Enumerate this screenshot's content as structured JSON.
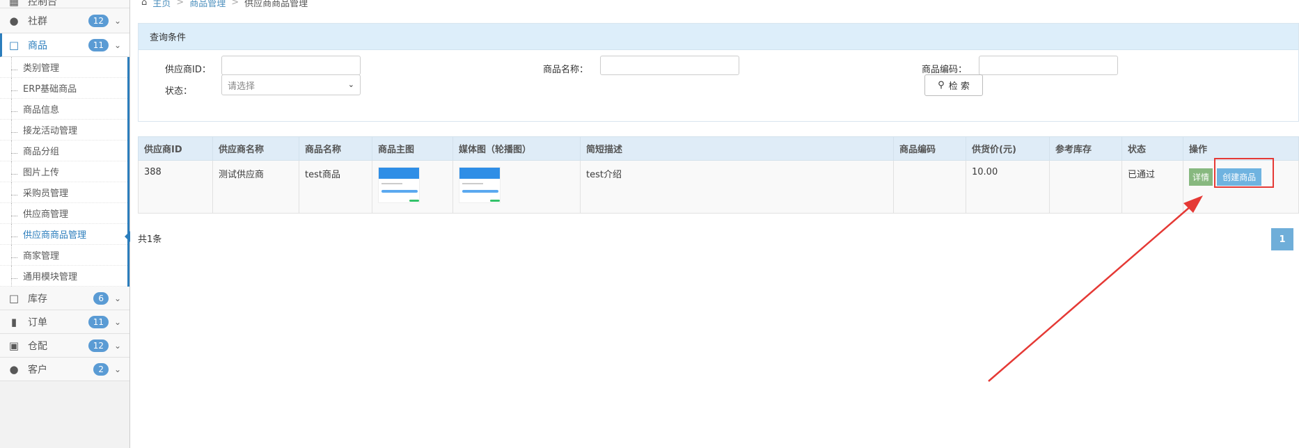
{
  "sidebar": {
    "top_item": {
      "label": "控制台",
      "icon": "dashboard-icon"
    },
    "items": [
      {
        "label": "社群",
        "badge": "12",
        "icon": "users-icon"
      },
      {
        "label": "商品",
        "badge": "11",
        "icon": "file-icon"
      },
      {
        "label": "库存",
        "badge": "6",
        "icon": "file-icon"
      },
      {
        "label": "订单",
        "badge": "11",
        "icon": "book-icon"
      },
      {
        "label": "仓配",
        "badge": "12",
        "icon": "truck-icon"
      },
      {
        "label": "客户",
        "badge": "2",
        "icon": "users-icon"
      }
    ],
    "submenu": [
      "类别管理",
      "ERP基础商品",
      "商品信息",
      "接龙活动管理",
      "商品分组",
      "图片上传",
      "采购员管理",
      "供应商管理",
      "供应商商品管理",
      "商家管理",
      "通用模块管理"
    ]
  },
  "breadcrumb": {
    "home": "主页",
    "level2": "商品管理",
    "current": "供应商商品管理"
  },
  "query": {
    "title": "查询条件",
    "supplier_id_label": "供应商ID：",
    "supplier_id_value": "",
    "product_name_label": "商品名称：",
    "product_name_value": "",
    "product_code_label": "商品编码：",
    "product_code_value": "",
    "status_label": "状态：",
    "status_value": "请选择",
    "search_button": "检 索"
  },
  "table": {
    "headers": [
      "供应商ID",
      "供应商名称",
      "商品名称",
      "商品主图",
      "媒体图（轮播图）",
      "简短描述",
      "商品编码",
      "供货价(元)",
      "参考库存",
      "状态",
      "操作"
    ],
    "rows": [
      {
        "supplier_id": "388",
        "supplier_name": "测试供应商",
        "product_name": "test商品",
        "description": "test介绍",
        "code": "",
        "price": "10.00",
        "stock": "",
        "status": "已通过",
        "detail_button": "详情",
        "create_button": "创建商品"
      }
    ]
  },
  "pagination": {
    "total": "共1条",
    "current_page": "1"
  },
  "colors": {
    "accent": "#2b7dbc",
    "header_bg": "#dfecf7",
    "annotation": "#e53935"
  }
}
